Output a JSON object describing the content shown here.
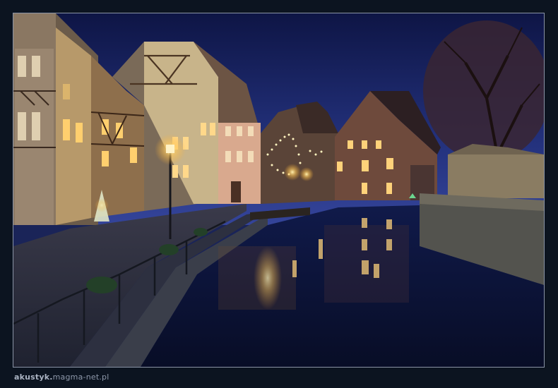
{
  "photo": {
    "subject": "night-canal-townscape",
    "colors": {
      "sky_top": "#0d1440",
      "sky_bottom": "#2a3a8a",
      "water": "#0b1233",
      "lamp_glow": "#ffd27a",
      "window_light": "#ffcf6e",
      "background": "#0c1420",
      "border": "#8a94a6"
    }
  },
  "credit": {
    "author": "akustyk.",
    "site": "magma-net.pl"
  }
}
